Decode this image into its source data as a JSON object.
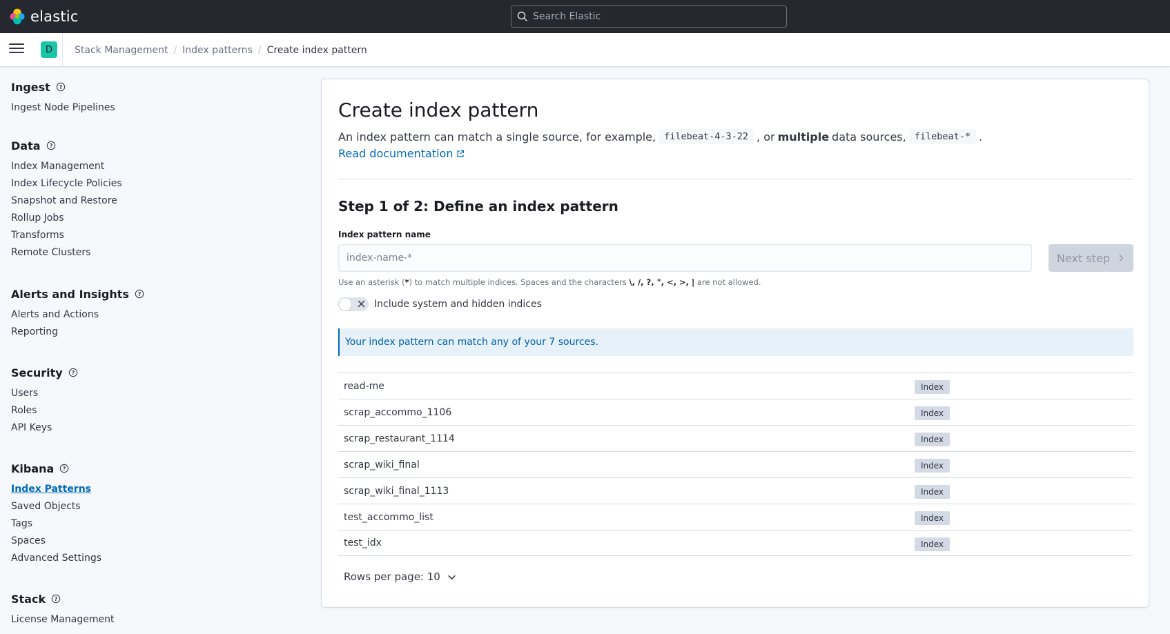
{
  "header": {
    "logo_text": "elastic",
    "search_placeholder": "Search Elastic"
  },
  "subbar": {
    "space_initial": "D",
    "breadcrumbs": [
      "Stack Management",
      "Index patterns",
      "Create index pattern"
    ]
  },
  "sidebar": {
    "groups": [
      {
        "title": "Ingest",
        "items": [
          "Ingest Node Pipelines"
        ]
      },
      {
        "title": "Data",
        "items": [
          "Index Management",
          "Index Lifecycle Policies",
          "Snapshot and Restore",
          "Rollup Jobs",
          "Transforms",
          "Remote Clusters"
        ]
      },
      {
        "title": "Alerts and Insights",
        "items": [
          "Alerts and Actions",
          "Reporting"
        ]
      },
      {
        "title": "Security",
        "items": [
          "Users",
          "Roles",
          "API Keys"
        ]
      },
      {
        "title": "Kibana",
        "items": [
          "Index Patterns",
          "Saved Objects",
          "Tags",
          "Spaces",
          "Advanced Settings"
        ]
      },
      {
        "title": "Stack",
        "items": [
          "License Management"
        ]
      }
    ],
    "active_item": "Index Patterns"
  },
  "main": {
    "title": "Create index pattern",
    "desc_1": "An index pattern can match a single source, for example,",
    "code_1": "filebeat-4-3-22",
    "desc_2": ", or",
    "desc_bold": "multiple",
    "desc_3": "data sources,",
    "code_2": "filebeat-*",
    "desc_4": ".",
    "doc_link": "Read documentation",
    "step_title": "Step 1 of 2: Define an index pattern",
    "field_label": "Index pattern name",
    "input_placeholder": "index-name-*",
    "input_value": "",
    "next_button": "Next step",
    "help_text_1": "Use an asterisk (",
    "help_star": "*",
    "help_text_2": ") to match multiple indices. Spaces and the characters",
    "help_chars": "\\, /, ?, \", <, >, |",
    "help_text_3": "are not allowed.",
    "toggle_label": "Include system and hidden indices",
    "toggle_on": false,
    "callout": "Your index pattern can match any of your 7 sources.",
    "sources": [
      {
        "name": "read-me",
        "type": "Index"
      },
      {
        "name": "scrap_accommo_1106",
        "type": "Index"
      },
      {
        "name": "scrap_restaurant_1114",
        "type": "Index"
      },
      {
        "name": "scrap_wiki_final",
        "type": "Index"
      },
      {
        "name": "scrap_wiki_final_1113",
        "type": "Index"
      },
      {
        "name": "test_accommo_list",
        "type": "Index"
      },
      {
        "name": "test_idx",
        "type": "Index"
      }
    ],
    "rows_per_page": "Rows per page: 10"
  },
  "colors": {
    "header_bg": "#25282f",
    "accent": "#006bb8",
    "space_avatar": "#1bc5a9"
  }
}
